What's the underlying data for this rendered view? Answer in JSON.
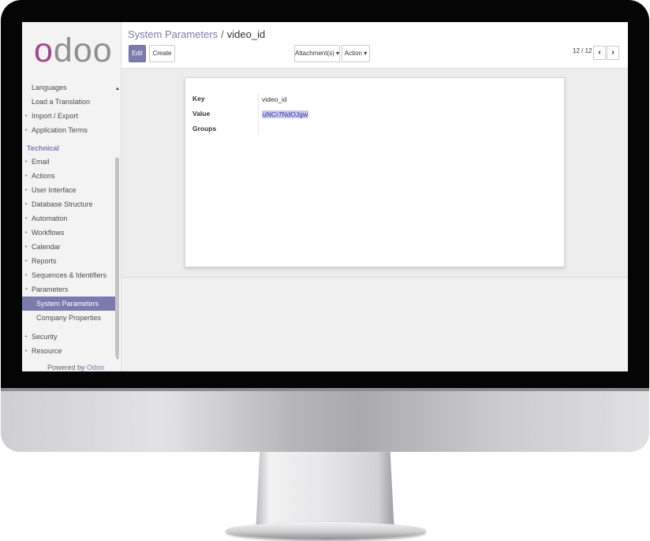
{
  "sidebar": {
    "logo": "odoo",
    "items_top": [
      {
        "label": "Languages",
        "caret": ""
      },
      {
        "label": "Load a Translation",
        "caret": ""
      },
      {
        "label": "Import / Export",
        "caret": "▸"
      },
      {
        "label": "Application Terms",
        "caret": "▸"
      }
    ],
    "section_header": "Technical",
    "items_technical": [
      {
        "label": "Email",
        "caret": "▸"
      },
      {
        "label": "Actions",
        "caret": "▸"
      },
      {
        "label": "User Interface",
        "caret": "▸"
      },
      {
        "label": "Database Structure",
        "caret": "▸"
      },
      {
        "label": "Automation",
        "caret": "▸"
      },
      {
        "label": "Workflows",
        "caret": "▸"
      },
      {
        "label": "Calendar",
        "caret": "▸"
      },
      {
        "label": "Reports",
        "caret": "▸"
      },
      {
        "label": "Sequences & Identifiers",
        "caret": "▸"
      },
      {
        "label": "Parameters",
        "caret": "▾"
      }
    ],
    "parameters_children": [
      {
        "label": "System Parameters",
        "active": true
      },
      {
        "label": "Company Properties",
        "active": false
      }
    ],
    "items_bottom": [
      {
        "label": "Security",
        "caret": "▸"
      },
      {
        "label": "Resource",
        "caret": "▸"
      }
    ],
    "powered_prefix": "Powered by",
    "powered_brand": "Odoo"
  },
  "breadcrumb": {
    "parent": "System Parameters",
    "separator": "/",
    "current": "video_id"
  },
  "toolbar": {
    "edit_label": "Edit",
    "create_label": "Create",
    "attachments_label": "Attachment(s) ▾",
    "action_label": "Action ▾"
  },
  "pager": {
    "value": "12 / 12",
    "prev_icon": "chevron-left-icon",
    "next_icon": "chevron-right-icon"
  },
  "form": {
    "key_label": "Key",
    "key_value": "video_id",
    "value_label": "Value",
    "value_value": "uNCr7NdOJgw",
    "groups_label": "Groups",
    "groups_value": ""
  },
  "colors": {
    "accent": "#7c7bad",
    "logo_accent": "#a24689",
    "selection": "#c9c9f0"
  }
}
